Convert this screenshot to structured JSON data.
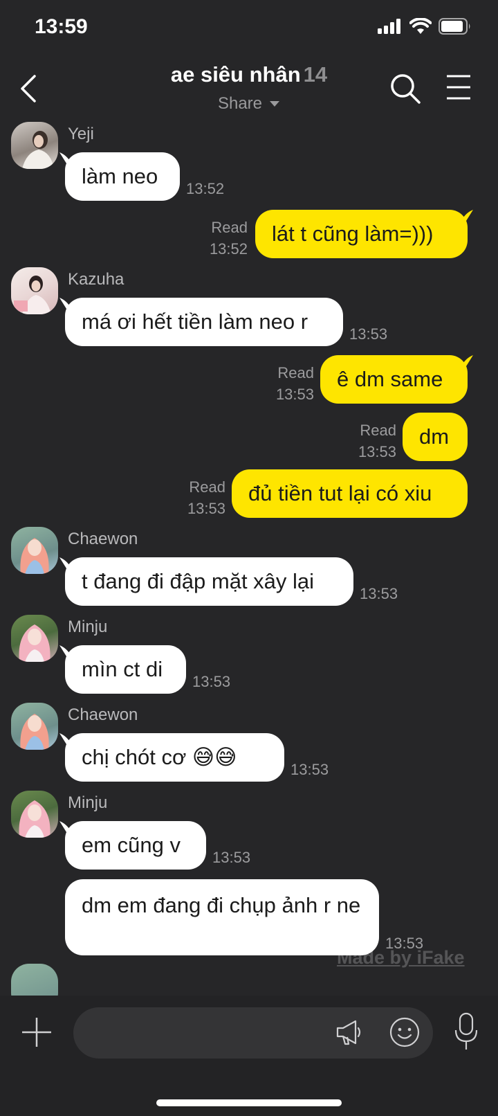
{
  "status": {
    "time": "13:59"
  },
  "header": {
    "title": "ae siêu nhân",
    "member_count": "14",
    "share_label": "Share"
  },
  "messages": [
    {
      "sender": "Yeji",
      "text": "làm neo",
      "time": "13:52"
    },
    {
      "text": "lát t cũng làm=)))",
      "read": "Read",
      "time": "13:52"
    },
    {
      "sender": "Kazuha",
      "text": "má ơi hết tiền làm neo r",
      "time": "13:53"
    },
    {
      "text": "ê dm same",
      "read": "Read",
      "time": "13:53"
    },
    {
      "text": "dm",
      "read": "Read",
      "time": "13:53"
    },
    {
      "text": "đủ tiền tut lại có xiu",
      "read": "Read",
      "time": "13:53"
    },
    {
      "sender": "Chaewon",
      "text": "t đang đi đập mặt xây lại",
      "time": "13:53"
    },
    {
      "sender": "Minju",
      "text": "mìn ct di",
      "time": "13:53"
    },
    {
      "sender": "Chaewon",
      "text": "chị chót cơ 😅😅",
      "time": "13:53"
    },
    {
      "sender": "Minju",
      "text": "em cũng v",
      "time": "13:53"
    },
    {
      "text": "dm em đang đi chụp ảnh r ne",
      "time": "13:53"
    }
  ],
  "watermark": "Made by iFake",
  "composer": {
    "placeholder": ""
  },
  "colors": {
    "background": "#262628",
    "outgoing_bubble": "#fee500",
    "incoming_bubble": "#ffffff"
  }
}
